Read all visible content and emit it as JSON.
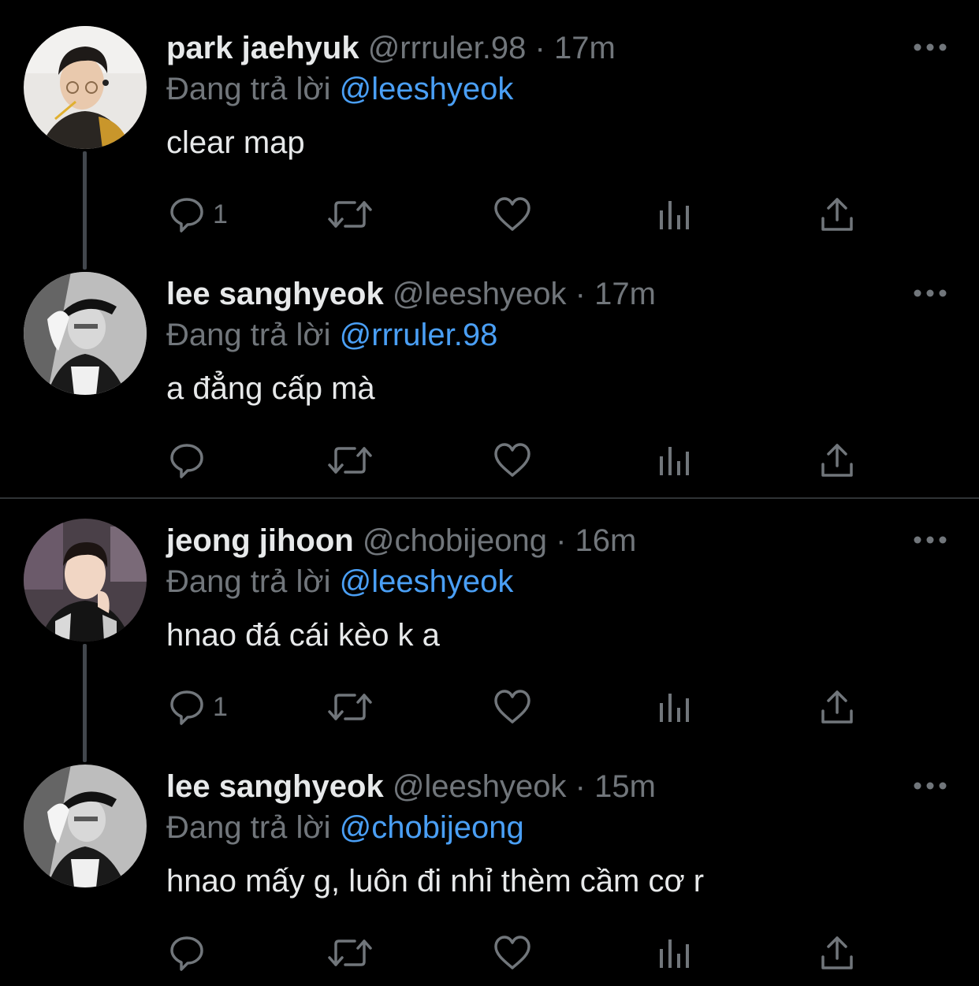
{
  "colors": {
    "background": "#000000",
    "primary_text": "#e7e9ea",
    "secondary_text": "#71767b",
    "mention": "#4a9ff5",
    "thread_line": "#42474d"
  },
  "tweets": [
    {
      "name": "park jaehyuk",
      "handle": "@rrruler.98",
      "dot": "·",
      "time": "17m",
      "reply_prefix": "Đang trả lời",
      "reply_to": "@leeshyeok",
      "text": "clear map",
      "reply_count": "1"
    },
    {
      "name": "lee sanghyeok",
      "handle": "@leeshyeok",
      "dot": "·",
      "time": "17m",
      "reply_prefix": "Đang trả lời",
      "reply_to": "@rrruler.98",
      "text": "a đẳng cấp mà",
      "reply_count": ""
    },
    {
      "name": "jeong jihoon",
      "handle": "@chobijeong",
      "dot": "·",
      "time": "16m",
      "reply_prefix": "Đang trả lời",
      "reply_to": "@leeshyeok",
      "text": "hnao đá cái kèo k a",
      "reply_count": "1"
    },
    {
      "name": "lee sanghyeok",
      "handle": "@leeshyeok",
      "dot": "·",
      "time": "15m",
      "reply_prefix": "Đang trả lời",
      "reply_to": "@chobijeong",
      "text": "hnao mấy g, luôn đi nhỉ thèm cầm cơ r",
      "reply_count": ""
    }
  ],
  "icons": {
    "more": "more-horizontal-icon",
    "reply": "reply-bubble-icon",
    "retweet": "retweet-icon",
    "like": "heart-icon",
    "views": "analytics-bars-icon",
    "share": "share-upload-icon"
  }
}
